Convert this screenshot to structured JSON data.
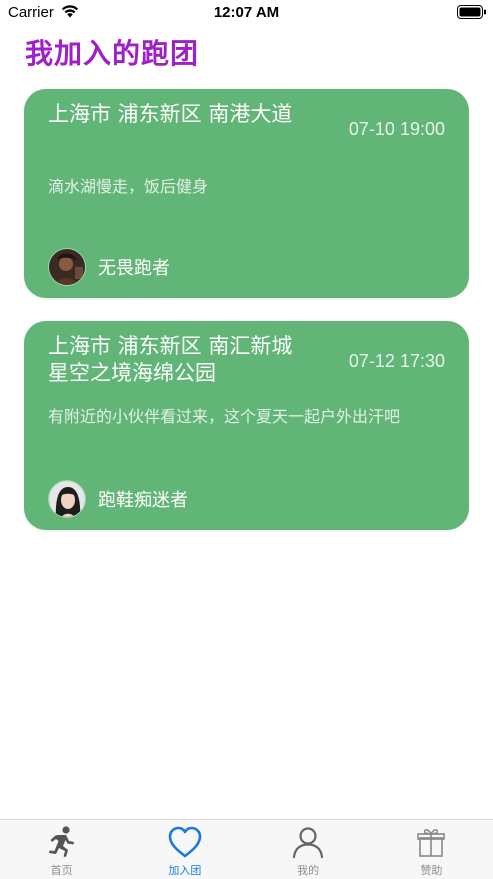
{
  "status_bar": {
    "carrier": "Carrier",
    "time": "12:07 AM"
  },
  "page": {
    "title": "我加入的跑团"
  },
  "runs": [
    {
      "location": "上海市 浦东新区 南港大道",
      "datetime": "07-10 19:00",
      "description": "滴水湖慢走，饭后健身",
      "user": "无畏跑者"
    },
    {
      "location": "上海市 浦东新区 南汇新城星空之境海绵公园",
      "datetime": "07-12 17:30",
      "description": "有附近的小伙伴看过来，这个夏天一起户外出汗吧",
      "user": "跑鞋痴迷者"
    }
  ],
  "tab_bar": {
    "tabs": [
      {
        "label": "首页",
        "icon": "runner-icon",
        "active": false
      },
      {
        "label": "加入团",
        "icon": "heart-icon",
        "active": true
      },
      {
        "label": "我的",
        "icon": "person-icon",
        "active": false
      },
      {
        "label": "赞助",
        "icon": "gift-icon",
        "active": false
      }
    ]
  },
  "colors": {
    "title": "#a020c8",
    "card": "#61b576",
    "active_tab": "#1a7ae3",
    "inactive_tab": "#8e8e8e"
  }
}
